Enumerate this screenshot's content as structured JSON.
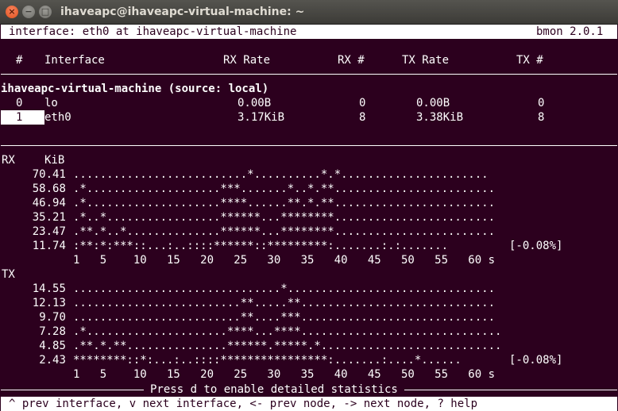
{
  "window": {
    "title": "ihaveapc@ihaveapc-virtual-machine: ~",
    "close_glyph": "×",
    "min_glyph": "−",
    "max_glyph": "□"
  },
  "status": {
    "left": "interface: eth0 at ihaveapc-virtual-machine",
    "right": "bmon 2.0.1"
  },
  "table": {
    "headers": {
      "num": "#",
      "interface": "Interface",
      "rx_rate": "RX Rate",
      "rx_num": "RX #",
      "tx_rate": "TX Rate",
      "tx_num": "TX #"
    },
    "group": "ihaveapc-virtual-machine (source: local)",
    "rows": [
      {
        "num": "0",
        "interface": "lo",
        "rx_rate": "0.00B",
        "rx_num": "0",
        "tx_rate": "0.00B",
        "tx_num": "0"
      },
      {
        "num": "1",
        "interface": "eth0",
        "rx_rate": "3.17KiB",
        "rx_num": "8",
        "tx_rate": "3.38KiB",
        "tx_num": "8"
      }
    ]
  },
  "rx_graph": {
    "label": "RX",
    "unit": "KiB",
    "rows": [
      {
        "value": "70.41",
        "plot": "..........................*..........*.*......................"
      },
      {
        "value": "58.68",
        "plot": ".*....................***.......*..*.**........................"
      },
      {
        "value": "46.94",
        "plot": ".*....................****......**.*.**........................"
      },
      {
        "value": "35.21",
        "plot": ".*..*.................******...********........................"
      },
      {
        "value": "23.47",
        "plot": ".**.*..*..............******...********........................"
      },
      {
        "value": "11.74",
        "plot": ":**:*:***::...:..::::******::*********:.......:.:.......",
        "suffix": "[-0.08%]"
      }
    ],
    "axis": "1   5    10   15   20   25   30   35   40   45   50   55   60 s"
  },
  "tx_graph": {
    "label": "TX",
    "unit": "KiB",
    "rows": [
      {
        "value": "14.55",
        "plot": "...............................*..............................."
      },
      {
        "value": "12.13",
        "plot": ".........................**.....**............................."
      },
      {
        "value": "9.70",
        "plot": ".........................**....***............................."
      },
      {
        "value": "7.28",
        "plot": ".*.....................****...****.............................."
      },
      {
        "value": "4.85",
        "plot": ".**.*.**...............******.*****.*..........................."
      },
      {
        "value": "2.43",
        "plot": "********::*:...:..::::****************:.......:....*......",
        "suffix": "[-0.08%]"
      }
    ],
    "axis": "1   5    10   15   20   25   30   35   40   45   50   55   60 s"
  },
  "footer": {
    "hint": "Press d to enable detailed statistics",
    "keys": "^ prev interface, v next interface, <- prev node, -> next node, ? help"
  },
  "colors": {
    "terminal_bg": "#2c001e",
    "terminal_fg": "#ffffff"
  }
}
